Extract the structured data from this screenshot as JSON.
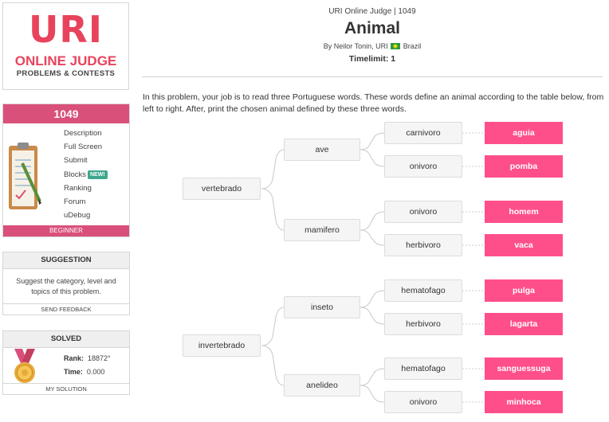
{
  "logo": {
    "big": "URI",
    "line1": "ONLINE JUDGE",
    "line2": "PROBLEMS & CONTESTS"
  },
  "sidebar": {
    "problem_number": "1049",
    "menu": [
      {
        "label": "Description"
      },
      {
        "label": "Full Screen"
      },
      {
        "label": "Submit"
      },
      {
        "label": "Blocks",
        "badge": "NEW!"
      },
      {
        "label": "Ranking"
      },
      {
        "label": "Forum"
      },
      {
        "label": "uDebug"
      }
    ],
    "level": "BEGINNER",
    "suggestion": {
      "title": "SUGGESTION",
      "text": "Suggest the category, level and topics of this problem.",
      "button": "SEND FEEDBACK"
    },
    "solved": {
      "title": "SOLVED",
      "rank_label": "Rank:",
      "rank_value": "18872°",
      "time_label": "Time:",
      "time_value": "0.000",
      "button": "MY SOLUTION"
    }
  },
  "header": {
    "subtitle": "URI Online Judge | 1049",
    "title": "Animal",
    "author_prefix": "By Neilor Tonin, URI",
    "country": "Brazil",
    "timelimit": "Timelimit: 1"
  },
  "description": "In this problem, your job is to read three Portuguese words. These words define an animal according to the table below, from left to right. After, print the chosen animal defined by these three words.",
  "tree": {
    "level1": [
      "vertebrado",
      "invertebrado"
    ],
    "level2": [
      "ave",
      "mamifero",
      "inseto",
      "anelideo"
    ],
    "level3": [
      "carnivoro",
      "onivoro",
      "onivoro",
      "herbivoro",
      "hematofago",
      "herbivoro",
      "hematofago",
      "onivoro"
    ],
    "animals": [
      "aguia",
      "pomba",
      "homem",
      "vaca",
      "pulga",
      "lagarta",
      "sanguessuga",
      "minhoca"
    ]
  },
  "colors": {
    "brand": "#e8435c",
    "sidebar_accent": "#d9507a",
    "leaf": "#ff4f8a",
    "badge": "#3fa68e"
  }
}
